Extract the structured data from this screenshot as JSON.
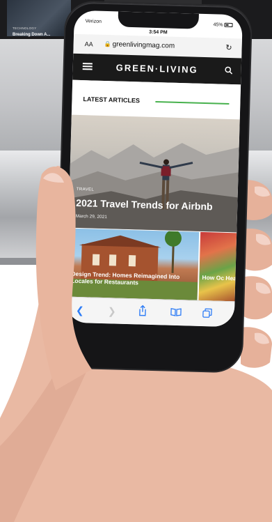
{
  "background": {
    "thumb_tag": "TECHNOLOGY",
    "thumb_title": "Breaking Down A..."
  },
  "status_bar": {
    "carrier": "Verizon",
    "time": "3:54 PM",
    "battery": "45%"
  },
  "browser": {
    "text_size_label": "AA",
    "url": "greenlivingmag.com"
  },
  "site": {
    "brand": "GREEN·LIVING",
    "section_title": "LATEST ARTICLES",
    "accent_color": "#47b14d"
  },
  "articles": {
    "hero": {
      "tag": "TRAVEL",
      "title": "2021 Travel Trends for Airbnb",
      "date": "March 29, 2021"
    },
    "card1": {
      "title": "Design Trend: Homes Reimagined Into Locales for Restaurants"
    },
    "card2": {
      "title": "How Oc Healthy Naidoo"
    }
  },
  "toolbar": {
    "back_icon": "chevron-left-icon",
    "forward_icon": "chevron-right-icon",
    "share_icon": "share-icon",
    "bookmarks_icon": "book-icon",
    "tabs_icon": "tabs-icon"
  }
}
